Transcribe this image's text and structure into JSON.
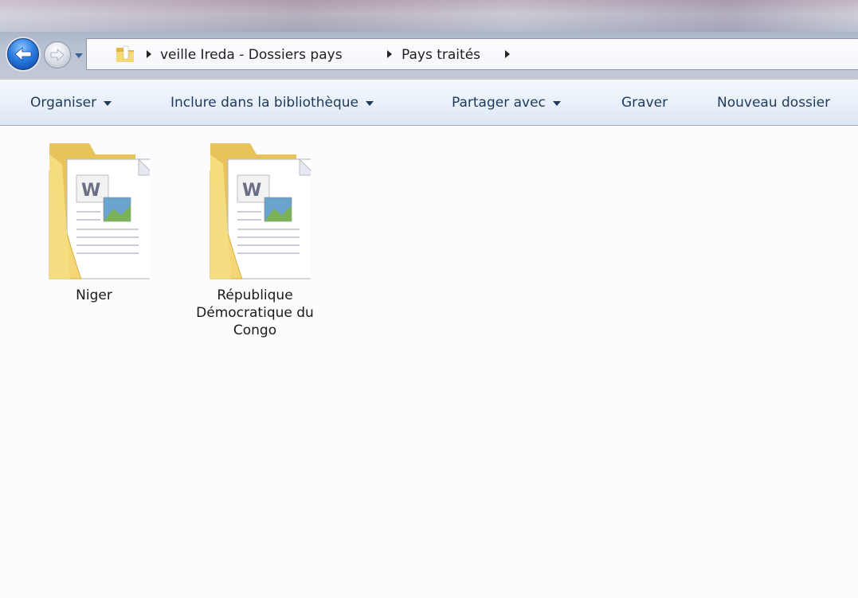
{
  "navigation": {
    "back_icon": "back-arrow-icon",
    "forward_icon": "forward-arrow-icon",
    "recent_icon": "chevron-down-icon"
  },
  "address_bar": {
    "folder_icon": "folder-icon",
    "breadcrumbs": [
      {
        "label": "veille Ireda - Dossiers pays"
      },
      {
        "label": "Pays traités"
      }
    ]
  },
  "commandbar": {
    "organize": "Organiser",
    "include_library": "Inclure dans la bibliothèque",
    "share_with": "Partager avec",
    "burn": "Graver",
    "new_folder": "Nouveau dossier"
  },
  "folders": [
    {
      "label": "Niger",
      "icon": "documents-folder-icon"
    },
    {
      "label": "République Démocratique du Congo",
      "icon": "documents-folder-icon"
    }
  ],
  "colors": {
    "commandbar_text": "#1e395b",
    "back_button": "#2a7de0",
    "folder_yellow": "#f4d77a"
  }
}
